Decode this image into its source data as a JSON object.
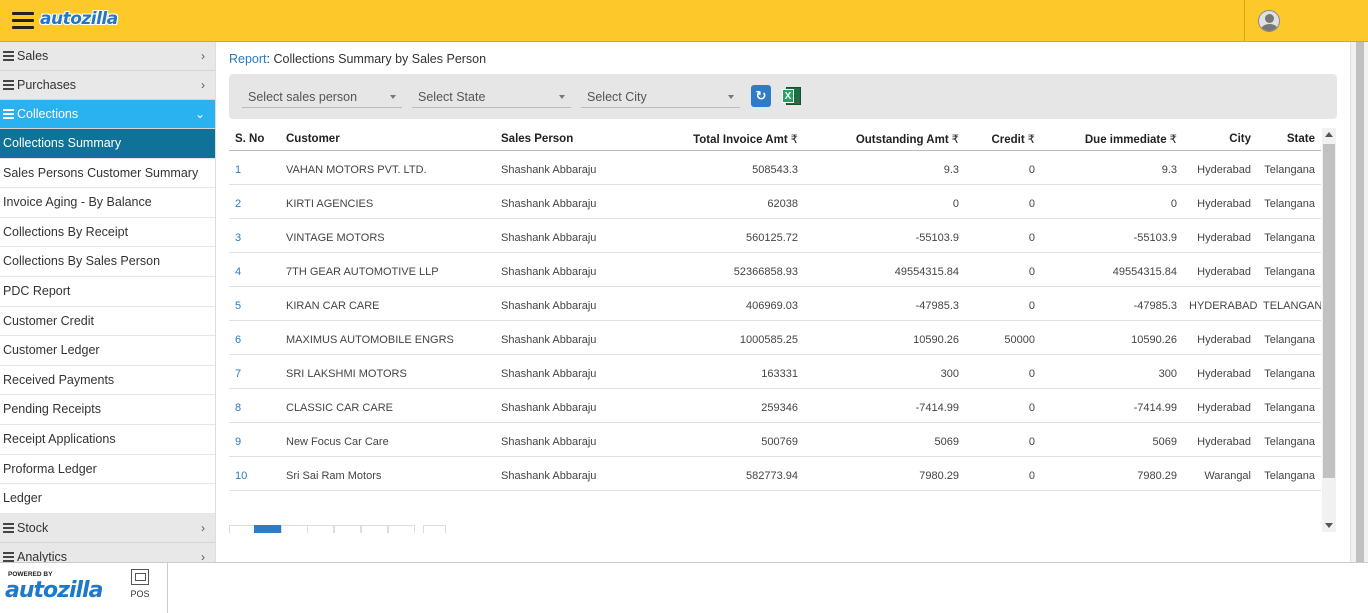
{
  "header": {
    "logo": "autozilla"
  },
  "sidebar": {
    "groups_top": [
      {
        "label": "Sales",
        "chevron": "›"
      },
      {
        "label": "Purchases",
        "chevron": "›"
      }
    ],
    "active_group": {
      "label": "Collections",
      "chevron": "⌄"
    },
    "items": [
      "Collections Summary",
      "Sales Persons Customer Summary",
      "Invoice Aging - By Balance",
      "Collections By Receipt",
      "Collections By Sales Person",
      "PDC Report",
      "Customer Credit",
      "Customer Ledger",
      "Received Payments",
      "Pending Receipts",
      "Receipt Applications",
      "Proforma Ledger",
      "Ledger"
    ],
    "groups_bottom": [
      {
        "label": "Stock",
        "chevron": "›"
      },
      {
        "label": "Analytics",
        "chevron": "›"
      }
    ]
  },
  "breadcrumb": {
    "link": "Report",
    "sep": ":",
    "title": "Collections Summary by Sales Person"
  },
  "filters": {
    "sales_person": "Select sales person",
    "state": "Select State",
    "city": "Select City",
    "refresh_glyph": "↻",
    "excel_glyph": "X"
  },
  "table": {
    "columns": {
      "sno": "S. No",
      "customer": "Customer",
      "sales_person": "Sales Person",
      "total_invoice": "Total Invoice Amt",
      "outstanding": "Outstanding Amt",
      "credit": "Credit",
      "due": "Due immediate",
      "city": "City",
      "state": "State",
      "currency": "₹"
    },
    "rows": [
      [
        "1",
        "VAHAN MOTORS PVT. LTD.",
        "Shashank Abbaraju",
        "508543.3",
        "9.3",
        "0",
        "9.3",
        "Hyderabad",
        "Telangana"
      ],
      [
        "2",
        "KIRTI AGENCIES",
        "Shashank Abbaraju",
        "62038",
        "0",
        "0",
        "0",
        "Hyderabad",
        "Telangana"
      ],
      [
        "3",
        "VINTAGE MOTORS",
        "Shashank Abbaraju",
        "560125.72",
        "-55103.9",
        "0",
        "-55103.9",
        "Hyderabad",
        "Telangana"
      ],
      [
        "4",
        "7TH GEAR AUTOMOTIVE LLP",
        "Shashank Abbaraju",
        "52366858.93",
        "49554315.84",
        "0",
        "49554315.84",
        "Hyderabad",
        "Telangana"
      ],
      [
        "5",
        "KIRAN CAR CARE",
        "Shashank Abbaraju",
        "406969.03",
        "-47985.3",
        "0",
        "-47985.3",
        "HYDERABAD",
        "TELANGANA"
      ],
      [
        "6",
        "MAXIMUS AUTOMOBILE ENGRS",
        "Shashank Abbaraju",
        "1000585.25",
        "10590.26",
        "50000",
        "10590.26",
        "Hyderabad",
        "Telangana"
      ],
      [
        "7",
        "SRI LAKSHMI MOTORS",
        "Shashank Abbaraju",
        "163331",
        "300",
        "0",
        "300",
        "Hyderabad",
        "Telangana"
      ],
      [
        "8",
        "CLASSIC CAR CARE",
        "Shashank Abbaraju",
        "259346",
        "-7414.99",
        "0",
        "-7414.99",
        "Hyderabad",
        "Telangana"
      ],
      [
        "9",
        "New Focus Car Care",
        "Shashank Abbaraju",
        "500769",
        "5069",
        "0",
        "5069",
        "Hyderabad",
        "Telangana"
      ],
      [
        "10",
        "Sri Sai Ram Motors",
        "Shashank Abbaraju",
        "582773.94",
        "7980.29",
        "0",
        "7980.29",
        "Warangal",
        "Telangana"
      ]
    ]
  },
  "footer": {
    "powered_by": "POWERED BY",
    "logo": "autozilla",
    "pos_label": "POS"
  }
}
